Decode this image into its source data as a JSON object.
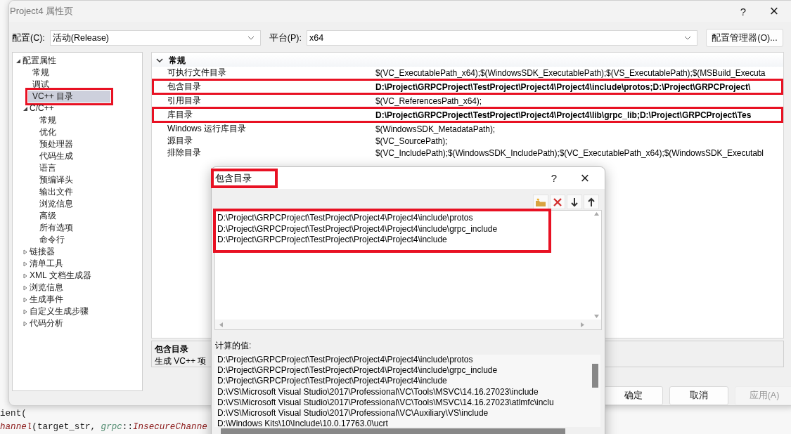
{
  "editor_lines": [
    [
      {
        "text": "ient(",
        "kind": "plain"
      }
    ],
    [
      {
        "text": "hannel",
        "kind": "func"
      },
      {
        "text": "(target_str, ",
        "kind": "plain"
      },
      {
        "text": "grpc",
        "kind": "ns"
      },
      {
        "text": "::",
        "kind": "plain"
      },
      {
        "text": "InsecureChanne",
        "kind": "func"
      }
    ]
  ],
  "window": {
    "title": "Project4 属性页",
    "help": "?",
    "close": "×"
  },
  "config": {
    "label": "配置(C):",
    "value": "活动(Release)"
  },
  "platform": {
    "label": "平台(P):",
    "value": "x64"
  },
  "config_manager_button": "配置管理器(O)...",
  "tree": [
    {
      "label": "配置属性",
      "expanded": true,
      "selected": false,
      "highlighted": false,
      "children": [
        {
          "label": "常规",
          "selected": false,
          "highlighted": false
        },
        {
          "label": "调试",
          "selected": false,
          "highlighted": false
        },
        {
          "label": "VC++ 目录",
          "selected": true,
          "highlighted": true
        },
        {
          "label": "C/C++",
          "expanded": true,
          "selected": false,
          "highlighted": false,
          "children": [
            {
              "label": "常规",
              "selected": false,
              "highlighted": false
            },
            {
              "label": "优化",
              "selected": false,
              "highlighted": false
            },
            {
              "label": "预处理器",
              "selected": false,
              "highlighted": false
            },
            {
              "label": "代码生成",
              "selected": false,
              "highlighted": false
            },
            {
              "label": "语言",
              "selected": false,
              "highlighted": false
            },
            {
              "label": "预编译头",
              "selected": false,
              "highlighted": false
            },
            {
              "label": "输出文件",
              "selected": false,
              "highlighted": false
            },
            {
              "label": "浏览信息",
              "selected": false,
              "highlighted": false
            },
            {
              "label": "高级",
              "selected": false,
              "highlighted": false
            },
            {
              "label": "所有选项",
              "selected": false,
              "highlighted": false
            },
            {
              "label": "命令行",
              "selected": false,
              "highlighted": false
            }
          ]
        },
        {
          "label": "链接器",
          "expanded": false,
          "selected": false,
          "highlighted": false
        },
        {
          "label": "清单工具",
          "expanded": false,
          "selected": false,
          "highlighted": false
        },
        {
          "label": "XML 文档生成器",
          "expanded": false,
          "selected": false,
          "highlighted": false
        },
        {
          "label": "浏览信息",
          "expanded": false,
          "selected": false,
          "highlighted": false
        },
        {
          "label": "生成事件",
          "expanded": false,
          "selected": false,
          "highlighted": false
        },
        {
          "label": "自定义生成步骤",
          "expanded": false,
          "selected": false,
          "highlighted": false
        },
        {
          "label": "代码分析",
          "expanded": false,
          "selected": false,
          "highlighted": false
        }
      ]
    }
  ],
  "grid": {
    "section": "常规",
    "expanded": true,
    "rows": [
      {
        "name": "可执行文件目录",
        "value": "$(VC_ExecutablePath_x64);$(WindowsSDK_ExecutablePath);$(VS_ExecutablePath);$(MSBuild_Executa",
        "modified": false,
        "highlighted": false
      },
      {
        "name": "包含目录",
        "value": "D:\\Project\\GRPCProject\\TestProject\\Project4\\Project4\\include\\protos;D:\\Project\\GRPCProject\\",
        "modified": true,
        "highlighted": true
      },
      {
        "name": "引用目录",
        "value": "$(VC_ReferencesPath_x64);",
        "modified": false,
        "highlighted": false
      },
      {
        "name": "库目录",
        "value": "D:\\Project\\GRPCProject\\TestProject\\Project4\\Project4\\lib\\grpc_lib;D:\\Project\\GRPCProject\\Tes",
        "modified": true,
        "highlighted": true
      },
      {
        "name": "Windows 运行库目录",
        "value": "$(WindowsSDK_MetadataPath);",
        "modified": false,
        "highlighted": false
      },
      {
        "name": "源目录",
        "value": "$(VC_SourcePath);",
        "modified": false,
        "highlighted": false
      },
      {
        "name": "排除目录",
        "value": "$(VC_IncludePath);$(WindowsSDK_IncludePath);$(VC_ExecutablePath_x64);$(WindowsSDK_Executabl",
        "modified": false,
        "highlighted": false
      }
    ]
  },
  "description": {
    "title": "包含目录",
    "text": "生成 VC++ 项"
  },
  "buttons": [
    {
      "label": "确定",
      "disabled": false
    },
    {
      "label": "取消",
      "disabled": false
    },
    {
      "label": "应用(A)",
      "disabled": true
    }
  ],
  "dialog": {
    "title": "包含目录",
    "title_highlighted": true,
    "help": "?",
    "close": "×",
    "list_highlighted": true,
    "entries": [
      "D:\\Project\\GRPCProject\\TestProject\\Project4\\Project4\\include\\protos",
      "D:\\Project\\GRPCProject\\TestProject\\Project4\\Project4\\include\\grpc_include",
      "D:\\Project\\GRPCProject\\TestProject\\Project4\\Project4\\include"
    ],
    "computed_label": "计算的值:",
    "computed": [
      "D:\\Project\\GRPCProject\\TestProject\\Project4\\Project4\\include\\protos",
      "D:\\Project\\GRPCProject\\TestProject\\Project4\\Project4\\include\\grpc_include",
      "D:\\Project\\GRPCProject\\TestProject\\Project4\\Project4\\include",
      "D:\\VS\\Microsoft Visual Studio\\2017\\Professional\\VC\\Tools\\MSVC\\14.16.27023\\include",
      "D:\\VS\\Microsoft Visual Studio\\2017\\Professional\\VC\\Tools\\MSVC\\14.16.27023\\atlmfc\\inclu",
      "D:\\VS\\Microsoft Visual Studio\\2017\\Professional\\VC\\Auxiliary\\VS\\include",
      "D:\\Windows Kits\\10\\Include\\10.0.17763.0\\ucrt"
    ]
  }
}
